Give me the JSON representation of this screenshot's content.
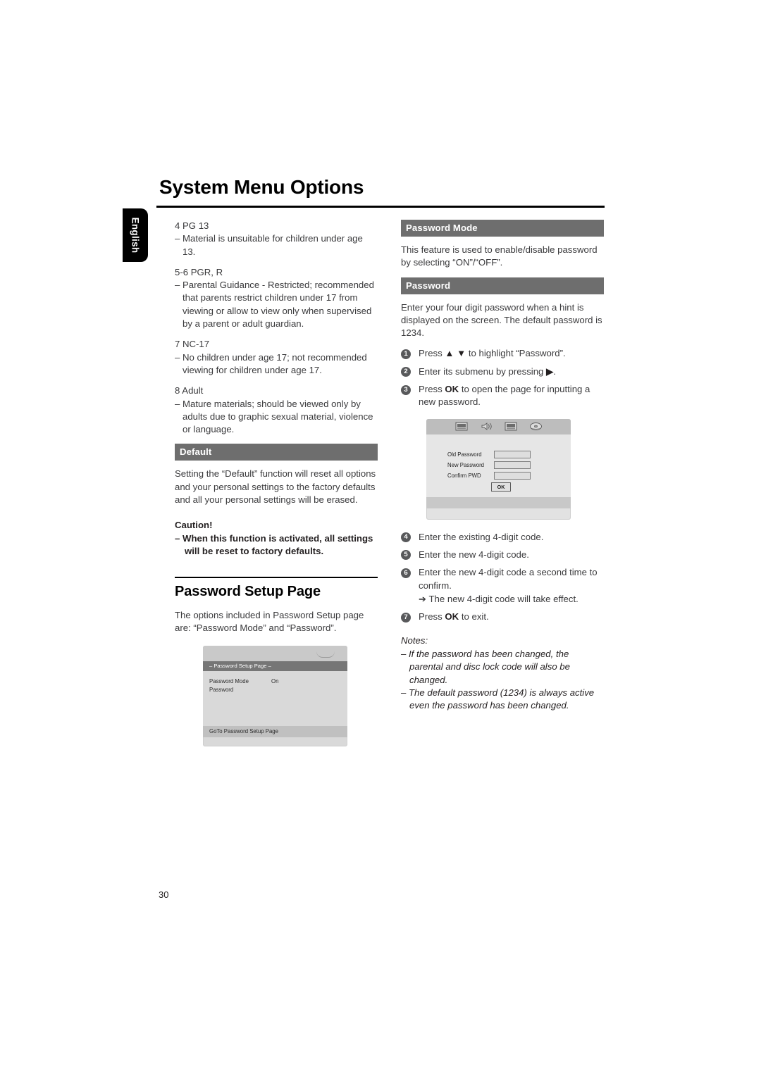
{
  "document": {
    "title": "System Menu Options",
    "language_tab": "English",
    "page_number": "30"
  },
  "left_column": {
    "rating_items": [
      {
        "heading": "4 PG 13",
        "text": "–   Material is unsuitable for children under age 13."
      },
      {
        "heading": "5-6 PGR, R",
        "text": "–   Parental Guidance - Restricted; recommended that parents restrict children under 17 from viewing or allow to view only when supervised by a parent or adult guardian."
      },
      {
        "heading": "7 NC-17",
        "text": "–   No children under age 17; not recommended viewing for children under age 17."
      },
      {
        "heading": "8 Adult",
        "text": "–   Mature materials; should be viewed only by adults due to graphic sexual material, violence or language."
      }
    ],
    "default_section": {
      "bar_label": "Default",
      "body": "Setting the “Default” function will reset all options and your personal settings to the factory defaults and all your personal settings will be erased."
    },
    "caution": {
      "title": "Caution!",
      "text": "–   When this function is activated, all settings will be reset to factory defaults."
    },
    "password_setup_section": {
      "heading": "Password Setup Page",
      "body": "The options included in Password Setup page are: “Password Mode” and “Password”."
    },
    "osd_setup_screen": {
      "title_bar": "– Password Setup Page –",
      "rows": [
        {
          "label": "Password Mode",
          "value": "On"
        },
        {
          "label": "Password",
          "value": ""
        }
      ],
      "footer": "GoTo Password Setup Page",
      "smile_icon": "smile-arc-icon"
    }
  },
  "right_column": {
    "password_mode_section": {
      "bar_label": "Password Mode",
      "body": "This feature is used to enable/disable password by selecting “ON”/“OFF”."
    },
    "password_section": {
      "bar_label": "Password",
      "body": "Enter your four digit password when a hint is displayed on the screen. The default password is 1234."
    },
    "steps_before": [
      {
        "num": "1",
        "pre": "Press ",
        "bold": "▲ ▼",
        "post": " to highlight “Password”."
      },
      {
        "num": "2",
        "pre": "Enter its submenu by pressing ",
        "bold": "▶",
        "post": "."
      },
      {
        "num": "3",
        "pre": "Press ",
        "bold": "OK",
        "post": " to open the page for inputting a new password."
      }
    ],
    "steps_after": [
      {
        "num": "4",
        "pre": "Enter the existing 4-digit code.",
        "bold": "",
        "post": ""
      },
      {
        "num": "5",
        "pre": "Enter the new 4-digit code.",
        "bold": "",
        "post": ""
      },
      {
        "num": "6",
        "pre": "Enter the new 4-digit code a second time to confirm.",
        "bold": "",
        "post": "",
        "arrow": "➔ The new 4-digit code will take effect."
      },
      {
        "num": "7",
        "pre": "Press ",
        "bold": "OK",
        "post": " to exit."
      }
    ],
    "osd_password_dialog": {
      "icons": [
        "tv-screen-icon",
        "speaker-icon",
        "tv-screen-icon",
        "disc-icon"
      ],
      "fields": [
        {
          "label": "Old Password",
          "value": ""
        },
        {
          "label": "New Password",
          "value": ""
        },
        {
          "label": "Confirm PWD",
          "value": ""
        }
      ],
      "ok_button": "OK"
    },
    "notes": {
      "title": "Notes:",
      "items": [
        "–  If the password has been changed, the parental and disc lock code will also be changed.",
        "–  The default password (1234) is always active even the password has been changed."
      ]
    }
  },
  "colors": {
    "bar_gray": "#6e6e6e",
    "badge_gray": "#58595b",
    "body_text": "#3a3a3c"
  }
}
